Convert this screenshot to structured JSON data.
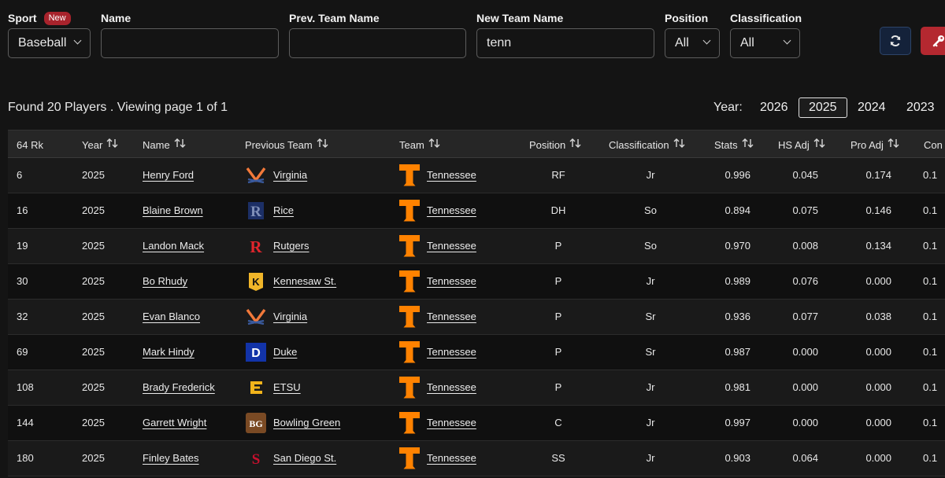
{
  "filters": {
    "sport": {
      "label": "Sport",
      "badge": "New",
      "value": "Baseball"
    },
    "name": {
      "label": "Name",
      "value": ""
    },
    "prev_team": {
      "label": "Prev. Team Name",
      "value": ""
    },
    "new_team": {
      "label": "New Team Name",
      "value": "tenn"
    },
    "position": {
      "label": "Position",
      "value": "All"
    },
    "classification": {
      "label": "Classification",
      "value": "All"
    }
  },
  "colors": {
    "accent_red": "#b42830",
    "refresh_bg": "#14223a",
    "tennessee_orange": "#ff8200"
  },
  "summary": "Found 20 Players . Viewing page 1 of 1",
  "years": {
    "label": "Year:",
    "options": [
      "2026",
      "2025",
      "2024",
      "2023"
    ],
    "selected": "2025"
  },
  "columns": [
    "64 Rk",
    "Year",
    "Name",
    "Previous Team",
    "Team",
    "Position",
    "Classification",
    "Stats",
    "HS Adj",
    "Pro Adj",
    "Con"
  ],
  "rows": [
    {
      "rk": "6",
      "year": "2025",
      "name": "Henry Ford",
      "prev": "Virginia",
      "prev_logo": "virginia",
      "team": "Tennessee",
      "pos": "RF",
      "cls": "Jr",
      "stats": "0.996",
      "hs": "0.045",
      "pro": "0.174",
      "con": "0.1"
    },
    {
      "rk": "16",
      "year": "2025",
      "name": "Blaine Brown",
      "prev": "Rice",
      "prev_logo": "rice",
      "team": "Tennessee",
      "pos": "DH",
      "cls": "So",
      "stats": "0.894",
      "hs": "0.075",
      "pro": "0.146",
      "con": "0.1"
    },
    {
      "rk": "19",
      "year": "2025",
      "name": "Landon Mack",
      "prev": "Rutgers",
      "prev_logo": "rutgers",
      "team": "Tennessee",
      "pos": "P",
      "cls": "So",
      "stats": "0.970",
      "hs": "0.008",
      "pro": "0.134",
      "con": "0.1"
    },
    {
      "rk": "30",
      "year": "2025",
      "name": "Bo Rhudy",
      "prev": "Kennesaw St.",
      "prev_logo": "kennesaw",
      "team": "Tennessee",
      "pos": "P",
      "cls": "Jr",
      "stats": "0.989",
      "hs": "0.076",
      "pro": "0.000",
      "con": "0.1"
    },
    {
      "rk": "32",
      "year": "2025",
      "name": "Evan Blanco",
      "prev": "Virginia",
      "prev_logo": "virginia",
      "team": "Tennessee",
      "pos": "P",
      "cls": "Sr",
      "stats": "0.936",
      "hs": "0.077",
      "pro": "0.038",
      "con": "0.1"
    },
    {
      "rk": "69",
      "year": "2025",
      "name": "Mark Hindy",
      "prev": "Duke",
      "prev_logo": "duke",
      "team": "Tennessee",
      "pos": "P",
      "cls": "Sr",
      "stats": "0.987",
      "hs": "0.000",
      "pro": "0.000",
      "con": "0.1"
    },
    {
      "rk": "108",
      "year": "2025",
      "name": "Brady Frederick",
      "prev": "ETSU",
      "prev_logo": "etsu",
      "team": "Tennessee",
      "pos": "P",
      "cls": "Jr",
      "stats": "0.981",
      "hs": "0.000",
      "pro": "0.000",
      "con": "0.1"
    },
    {
      "rk": "144",
      "year": "2025",
      "name": "Garrett Wright",
      "prev": "Bowling Green",
      "prev_logo": "bgsu",
      "team": "Tennessee",
      "pos": "C",
      "cls": "Jr",
      "stats": "0.997",
      "hs": "0.000",
      "pro": "0.000",
      "con": "0.1"
    },
    {
      "rk": "180",
      "year": "2025",
      "name": "Finley Bates",
      "prev": "San Diego St.",
      "prev_logo": "sdsu",
      "team": "Tennessee",
      "pos": "SS",
      "cls": "Jr",
      "stats": "0.903",
      "hs": "0.064",
      "pro": "0.000",
      "con": "0.1"
    }
  ]
}
